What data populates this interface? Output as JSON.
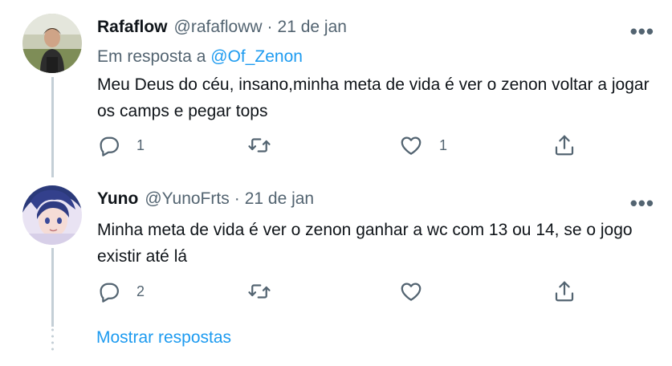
{
  "tweets": [
    {
      "name": "Rafaflow",
      "handle": "@rafafloww",
      "separator": "·",
      "time": "21 de jan",
      "more": "•••",
      "reply_prefix": "Em resposta a",
      "reply_to": "@Of_Zenon",
      "text": "Meu Deus do céu,  insano,minha meta de vida é ver o zenon voltar a jogar os camps e pegar tops",
      "reply_count": "1",
      "retweet_count": "",
      "like_count": "1"
    },
    {
      "name": "Yuno",
      "handle": "@YunoFrts",
      "separator": "·",
      "time": "21 de jan",
      "more": "•••",
      "text": "Minha meta de vida é ver o zenon ganhar a wc com 13 ou 14, se o jogo existir até lá",
      "reply_count": "2",
      "retweet_count": "",
      "like_count": ""
    }
  ],
  "show_replies": "Mostrar respostas",
  "colors": {
    "accent": "#1d9bf0",
    "secondary_text": "#536471",
    "thread_line": "#c4cfd6"
  }
}
